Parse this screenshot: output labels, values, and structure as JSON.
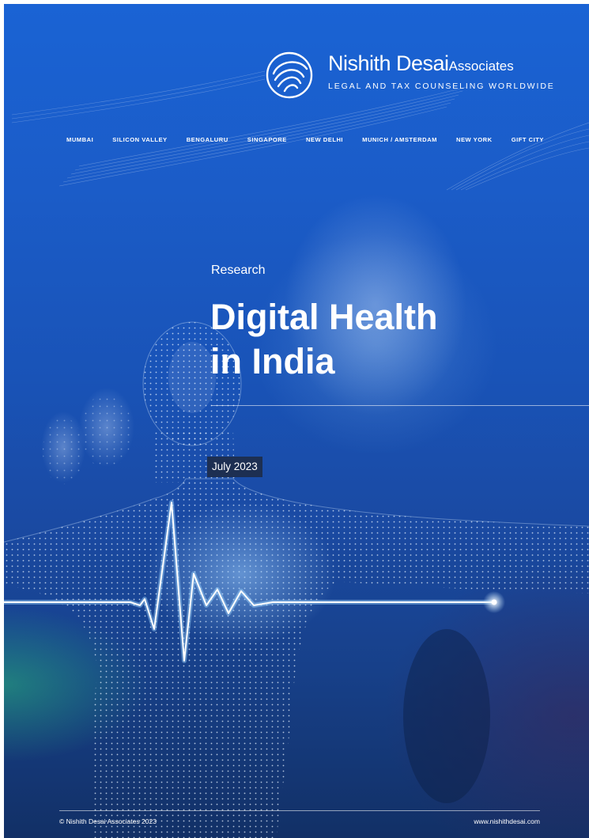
{
  "header": {
    "brand_name": "Nishith Desai",
    "brand_suffix": "Associates",
    "tagline": "LEGAL AND TAX COUNSELING WORLDWIDE",
    "logo_icon": "swirl-logo-icon",
    "offices": [
      "MUMBAI",
      "SILICON VALLEY",
      "BENGALURU",
      "SINGAPORE",
      "NEW DELHI",
      "MUNICH / AMSTERDAM",
      "NEW YORK",
      "GIFT CITY"
    ]
  },
  "cover": {
    "category": "Research",
    "title_line1": "Digital Health",
    "title_line2": "in India",
    "date": "July 2023",
    "illustration": "wireframe-human-heartbeat-illustration"
  },
  "footer": {
    "copyright": "© Nishith Desai Associates 2023",
    "website": "www.nishithdesai.com"
  },
  "colors": {
    "background_top": "#1a63d4",
    "background_bottom": "#123066",
    "date_badge": "#1d2f52",
    "pulse_glow": "#bfe6ff",
    "text": "#ffffff"
  }
}
